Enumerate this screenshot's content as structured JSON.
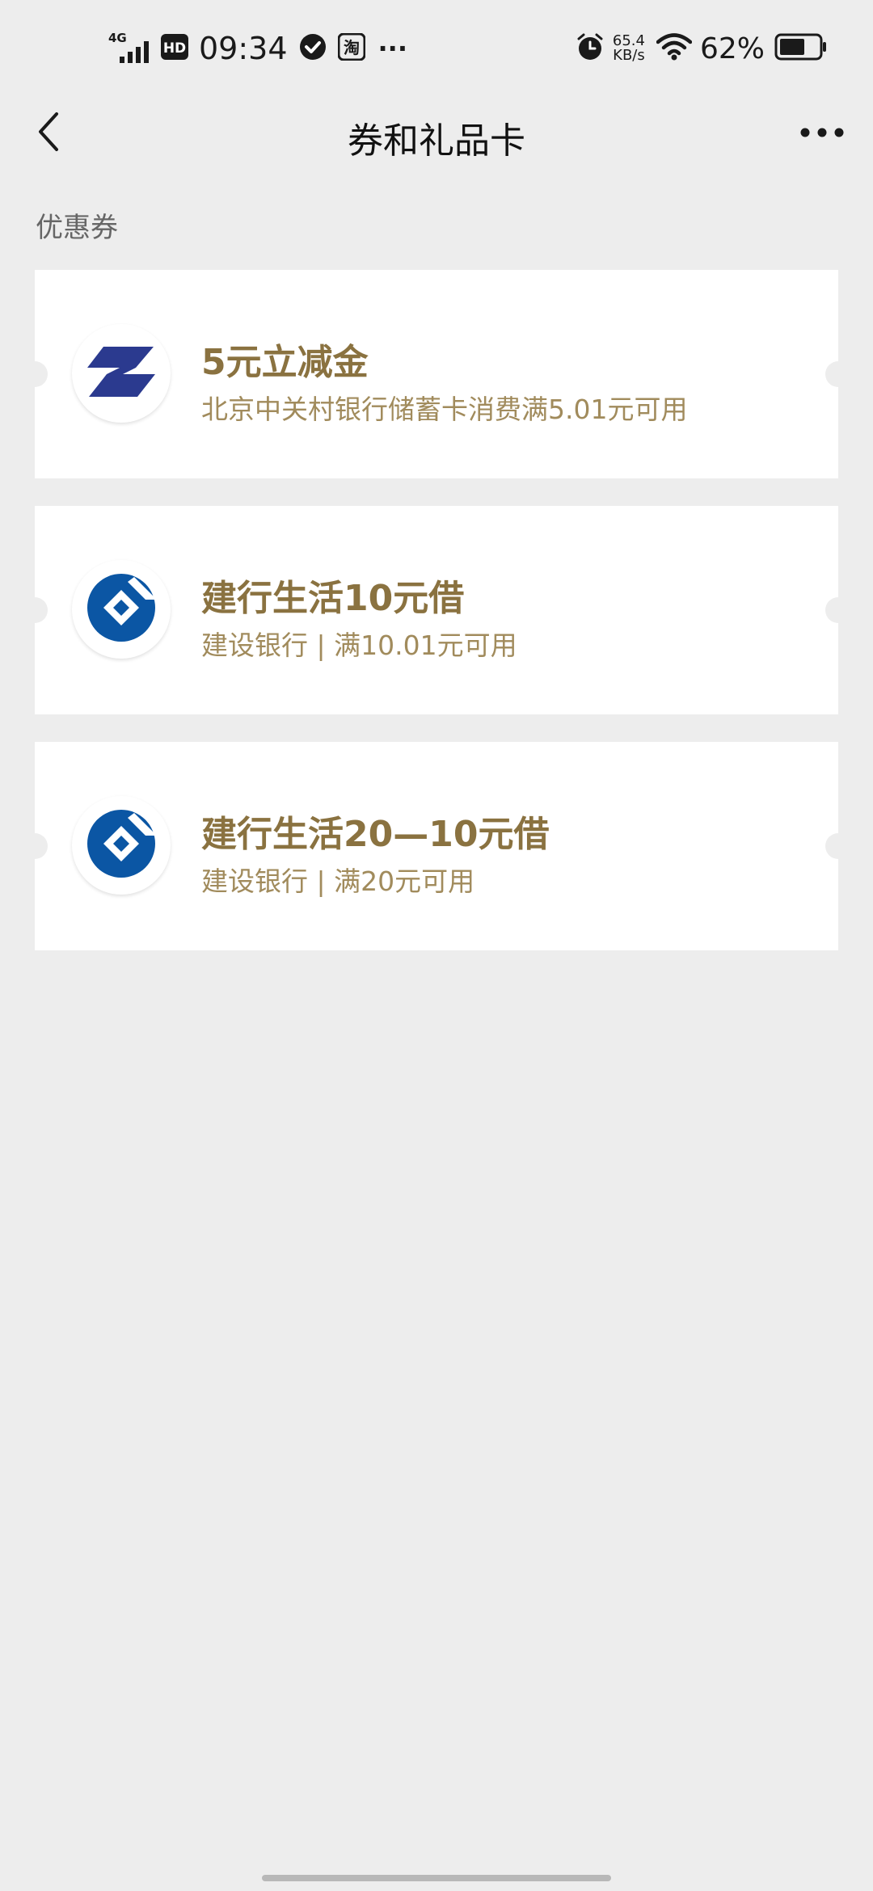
{
  "status_bar": {
    "network": "4G",
    "hd_badge": "HD",
    "time": "09:34",
    "taobao_badge": "淘",
    "more": "···",
    "speed_value": "65.4",
    "speed_unit": "KB/s",
    "battery_percent": "62%"
  },
  "nav": {
    "title": "券和礼品卡"
  },
  "section": {
    "label": "优惠券"
  },
  "coupons": [
    {
      "title": "5元立减金",
      "desc": "北京中关村银行储蓄卡消费满5.01元可用",
      "logo": "zgc-bank-logo-icon"
    },
    {
      "title": "建行生活10元借",
      "desc": "建设银行 | 满10.01元可用",
      "logo": "ccb-logo-icon"
    },
    {
      "title": "建行生活20—10元借",
      "desc": "建设银行 | 满20元可用",
      "logo": "ccb-logo-icon"
    }
  ],
  "colors": {
    "background": "#ededed",
    "card": "#ffffff",
    "coupon_title": "#8a7240",
    "coupon_desc": "#a18b5c",
    "zgc_blue": "#2b3a8f",
    "ccb_blue": "#0b56a4"
  }
}
